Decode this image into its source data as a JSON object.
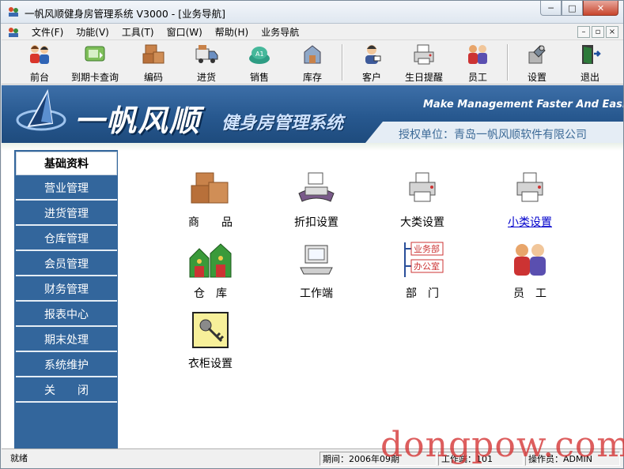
{
  "window": {
    "title": "一帆风顺健身房管理系统 V3000 - [业务导航]",
    "minimize": "─",
    "maximize": "□",
    "close": "✕"
  },
  "menubar": {
    "items": [
      "文件(F)",
      "功能(V)",
      "工具(T)",
      "窗口(W)",
      "帮助(H)",
      "业务导航"
    ],
    "mdi_buttons": [
      "–",
      "▫",
      "×"
    ]
  },
  "toolbar": {
    "buttons": [
      {
        "label": "前台",
        "icon": "people-icon"
      },
      {
        "label": "到期卡查询",
        "icon": "card-icon"
      },
      {
        "label": "编码",
        "icon": "boxes-icon"
      },
      {
        "label": "进货",
        "icon": "truck-icon"
      },
      {
        "label": "销售",
        "icon": "sales-icon"
      },
      {
        "label": "库存",
        "icon": "inventory-icon"
      },
      {
        "label": "客户",
        "icon": "customer-icon"
      },
      {
        "label": "生日提醒",
        "icon": "printer-icon"
      },
      {
        "label": "员工",
        "icon": "staff-icon"
      },
      {
        "label": "设置",
        "icon": "settings-icon"
      },
      {
        "label": "退出",
        "icon": "exit-icon"
      }
    ]
  },
  "banner": {
    "brand": "一帆风顺",
    "subtitle": "健身房管理系统",
    "slogan": "Make Management Faster And Easier",
    "license": "授权单位：青岛一帆风顺软件有限公司"
  },
  "sidebar": {
    "items": [
      "基础资料",
      "营业管理",
      "进货管理",
      "仓库管理",
      "会员管理",
      "财务管理",
      "报表中心",
      "期末处理",
      "系统维护",
      "关　　闭"
    ],
    "active_index": 0
  },
  "features": [
    {
      "label": "商　　品",
      "icon": "goods-icon"
    },
    {
      "label": "折扣设置",
      "icon": "discount-icon"
    },
    {
      "label": "大类设置",
      "icon": "category-icon"
    },
    {
      "label": "小类设置",
      "icon": "subcategory-icon",
      "link": true
    },
    {
      "label": "仓　库",
      "icon": "warehouse-icon"
    },
    {
      "label": "工作端",
      "icon": "terminal-icon"
    },
    {
      "label": "部　门",
      "icon": "department-icon"
    },
    {
      "label": "员　工",
      "icon": "employee-icon"
    },
    {
      "label": "衣柜设置",
      "icon": "locker-icon"
    }
  ],
  "department_icon": {
    "line1": "业务部",
    "line2": "办公室"
  },
  "statusbar": {
    "status": "就绪",
    "period": "期间：2006年09期",
    "terminal": "工作端：101",
    "operator": "操作员：ADMIN"
  },
  "watermark": "dongpow.com",
  "colors": {
    "sidebar_bg": "#33669c",
    "banner_bg": "#27588f",
    "license_text": "#3c6a97",
    "watermark": "#d63b3b"
  }
}
